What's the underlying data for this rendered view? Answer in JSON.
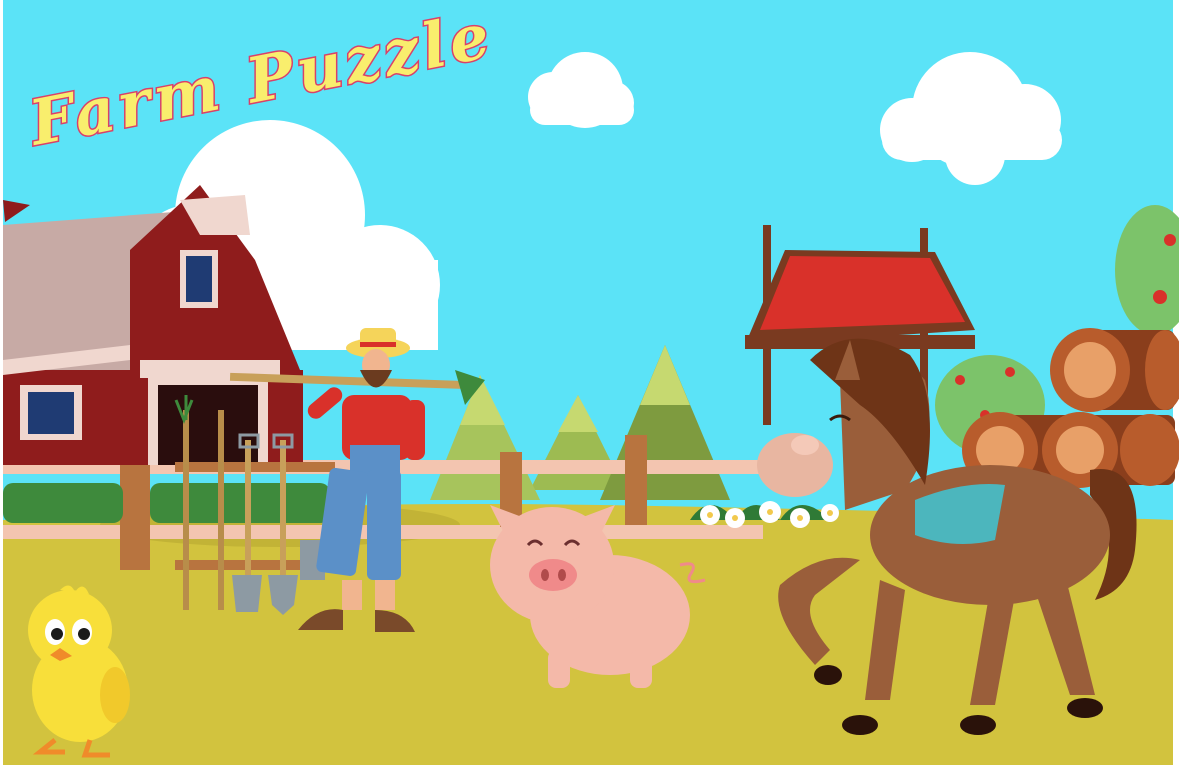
{
  "game": {
    "title": "Farm Puzzle"
  },
  "colors": {
    "sky": "#5be3f7",
    "ground": "#d2c33e",
    "title_fill": "#f9ee6d",
    "title_stroke": "#d9406a",
    "barn_red": "#8f1c1c",
    "barn_roof": "#c7aaa5",
    "well_roof": "#d9312a",
    "horse_brown": "#9a5e3a",
    "pig_pink": "#f4b9a9",
    "chick_yellow": "#f8df3a",
    "saddle_teal": "#4cb6bd"
  },
  "scene_items": [
    {
      "name": "barn-icon",
      "interactable": false
    },
    {
      "name": "farmer-icon",
      "interactable": true
    },
    {
      "name": "garden-tools-icon",
      "interactable": true
    },
    {
      "name": "well-icon",
      "interactable": true
    },
    {
      "name": "logs-icon",
      "interactable": true
    },
    {
      "name": "horse-icon",
      "interactable": true
    },
    {
      "name": "pig-icon",
      "interactable": true
    },
    {
      "name": "chick-icon",
      "interactable": true
    }
  ]
}
